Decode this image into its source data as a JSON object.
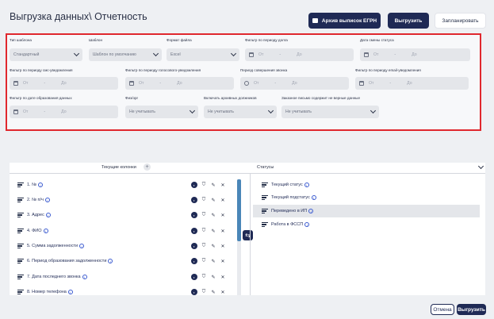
{
  "page": {
    "title": "Выгрузка данных\\ Отчетность"
  },
  "header": {
    "archive_label": "Архив выписок ЕГРН",
    "export_label": "Выгрузить",
    "schedule_label": "Запланировать"
  },
  "filters": {
    "template_type": {
      "label": "Тип шаблона",
      "value": "Стандартный"
    },
    "template": {
      "label": "Шаблон",
      "value": "Шаблон по умолчанию"
    },
    "file_format": {
      "label": "Формат файла",
      "value": "Excel"
    },
    "debt_period": {
      "label": "Фильтр по периоду долга",
      "from": "От",
      "to": "До"
    },
    "status_date": {
      "label": "Дата смены статуса",
      "from": "От",
      "to": "До"
    },
    "sms_period": {
      "label": "Фильтр по периоду смс-уведомления",
      "from": "От",
      "to": "До"
    },
    "voice_period": {
      "label": "Фильтр по периоду голосового-уведомления",
      "from": "От",
      "to": "До"
    },
    "call_period": {
      "label": "Период совершения звонка",
      "from": "От",
      "to": "До"
    },
    "email_period": {
      "label": "Фильтр по периоду email-уведомления",
      "from": "От",
      "to": "До"
    },
    "debt_date": {
      "label": "Фильтр по дате образования данных",
      "from": "От",
      "to": "До"
    },
    "person_type": {
      "label": "Физ/орг",
      "value": "Не учитывать"
    },
    "archived": {
      "label": "Включать архивных должников",
      "value": "Не учитывать"
    },
    "letter": {
      "label": "Заказное письмо содержит не верные данные",
      "value": "Не учитывать"
    }
  },
  "columns": {
    "title": "Текущие колонки",
    "add_symbol": "+",
    "items": [
      "1. №",
      "2. № п/ч",
      "3. Адрес",
      "4. ФИО",
      "5. Сумма задолженности",
      "6. Период образования задолженности",
      "7. Дата последнего звонка",
      "8. Номер телефона"
    ]
  },
  "statuses": {
    "title": "Статусы",
    "items": [
      "Текущий статус",
      "Текущий подстатус",
      "Переведено в ИП",
      "Работа в ФССП"
    ],
    "highlighted_index": 2
  },
  "footer": {
    "cancel_label": "Отмена",
    "export_label": "Выгрузить"
  },
  "colors": {
    "accent": "#1f2a55",
    "frame": "#e0282e",
    "link": "#3a5ad0"
  }
}
